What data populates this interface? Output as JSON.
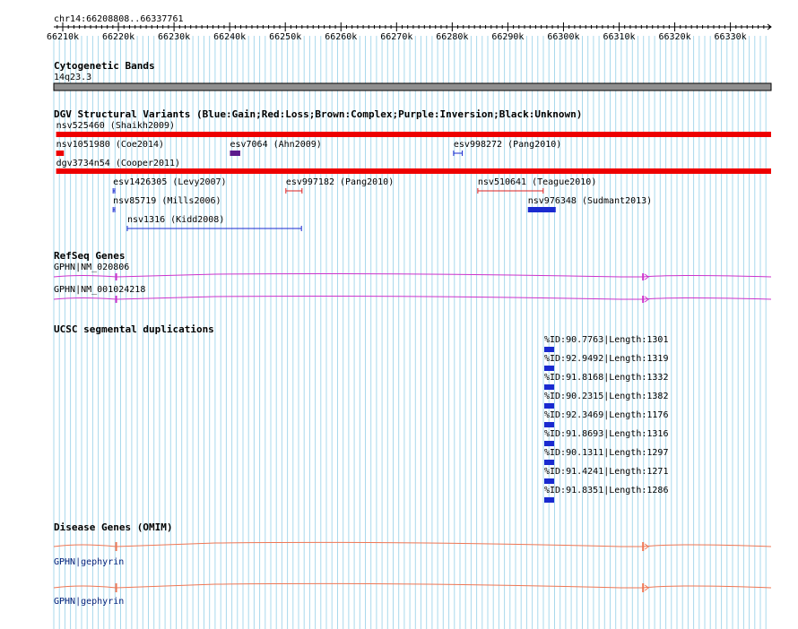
{
  "ruler": {
    "position_label": "chr14:66208808..66337761",
    "ticks": [
      "66210k",
      "66220k",
      "66230k",
      "66240k",
      "66250k",
      "66260k",
      "66270k",
      "66280k",
      "66290k",
      "66300k",
      "66310k",
      "66320k",
      "66330k"
    ]
  },
  "tracks": {
    "cytoband": {
      "title": "Cytogenetic Bands",
      "band_label": "14q23.3"
    },
    "dgv": {
      "title": "DGV Structural Variants (Blue:Gain;Red:Loss;Brown:Complex;Purple:Inversion;Black:Unknown)",
      "features": [
        {
          "label": "nsv525460 (Shaikh2009)",
          "start": 66208808,
          "end": 66337761,
          "style": "thick",
          "color": "#ee0000"
        },
        {
          "label": "nsv1051980 (Coe2014)",
          "start": 66208808,
          "end": 66210200,
          "style": "box",
          "color": "#ee0000"
        },
        {
          "label": "esv7064 (Ahn2009)",
          "start": 66240050,
          "end": 66241900,
          "style": "box",
          "color": "#5a1a8c"
        },
        {
          "label": "esv998272 (Pang2010)",
          "start": 66280250,
          "end": 66281800,
          "style": "bracket",
          "color": "#1a2ad0"
        },
        {
          "label": "dgv3734n54 (Cooper2011)",
          "start": 66208808,
          "end": 66337761,
          "style": "thick",
          "color": "#ee0000"
        },
        {
          "label": "esv1426305 (Levy2007)",
          "start": 66219050,
          "end": 66219350,
          "style": "bracket",
          "color": "#1a2ad0"
        },
        {
          "label": "esv997182 (Pang2010)",
          "start": 66250100,
          "end": 66253000,
          "style": "bracket",
          "color": "#dd2222"
        },
        {
          "label": "nsv510641 (Teague2010)",
          "start": 66284600,
          "end": 66296350,
          "style": "bracket",
          "color": "#dd2222"
        },
        {
          "label": "nsv85719 (Mills2006)",
          "start": 66219050,
          "end": 66219350,
          "style": "bracket",
          "color": "#1a2ad0"
        },
        {
          "label": "nsv976348 (Sudmant2013)",
          "start": 66293600,
          "end": 66298600,
          "style": "box",
          "color": "#1a2ad0"
        },
        {
          "label": "nsv1316 (Kidd2008)",
          "start": 66221600,
          "end": 66252900,
          "style": "bracket",
          "color": "#1a2ad0"
        }
      ]
    },
    "refseq": {
      "title": "RefSeq Genes",
      "genes": [
        {
          "label": "GPHN|NM_020806"
        },
        {
          "label": "GPHN|NM_001024218"
        }
      ]
    },
    "segdup": {
      "title": "UCSC segmental duplications",
      "items": [
        {
          "label": "%ID:90.7763|Length:1301"
        },
        {
          "label": "%ID:92.9492|Length:1319"
        },
        {
          "label": "%ID:91.8168|Length:1332"
        },
        {
          "label": "%ID:90.2315|Length:1382"
        },
        {
          "label": "%ID:92.3469|Length:1176"
        },
        {
          "label": "%ID:91.8693|Length:1316"
        },
        {
          "label": "%ID:90.1311|Length:1297"
        },
        {
          "label": "%ID:91.4241|Length:1271"
        },
        {
          "label": "%ID:91.8351|Length:1286"
        }
      ]
    },
    "omim": {
      "title": "Disease Genes (OMIM)",
      "genes": [
        {
          "label": "GPHN|gephyrin"
        },
        {
          "label": "GPHN|gephyrin"
        }
      ]
    }
  },
  "colors": {
    "grid_line": "#a9d9ec",
    "refseq_gene": "#cc33cc",
    "omim_gene": "#ee7755",
    "segdup_box": "#1a2ad0",
    "cytoband": "#8f8f8f"
  }
}
